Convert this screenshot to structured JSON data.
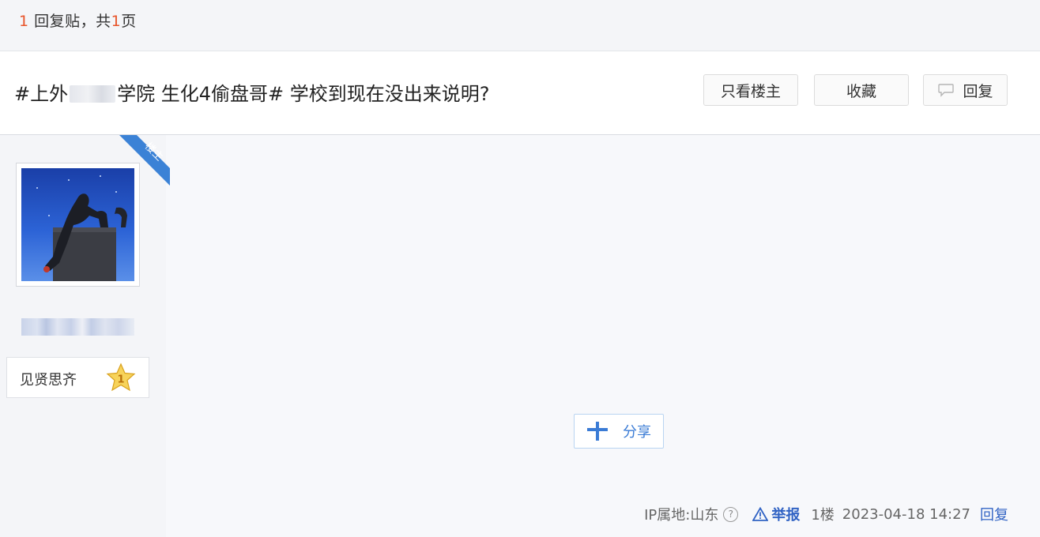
{
  "header": {
    "reply_num": "1",
    "reply_text": "回复贴，共",
    "page_num": "1",
    "page_text": "页"
  },
  "post": {
    "title_part1": "#上外",
    "title_part2": "学院 生化4偷盘哥# 学校到现在没出来说明?"
  },
  "actions": {
    "only_op": "只看楼主",
    "favorite": "收藏",
    "reply": "回复"
  },
  "author": {
    "badge": "楼主",
    "level_name": "见贤思齐",
    "level_num": "1"
  },
  "share": {
    "label": "分享"
  },
  "footer": {
    "ip_label": "IP属地:山东",
    "help": "?",
    "report": "举报",
    "floor": "1楼",
    "time": "2023-04-18 14:27",
    "reply": "回复"
  },
  "colors": {
    "accent": "#3163c4",
    "badge": "#3b82d6",
    "highlight": "#e8542a"
  }
}
